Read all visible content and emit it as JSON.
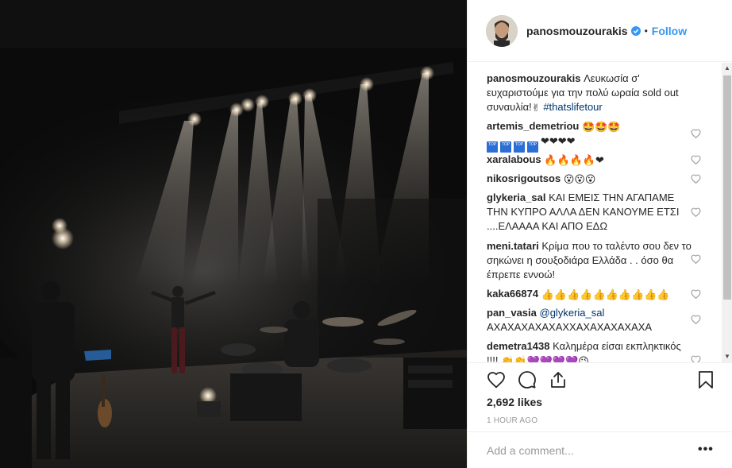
{
  "post": {
    "username": "panosmouzourakis",
    "separator": "•",
    "follow_label": "Follow",
    "caption": {
      "user": "panosmouzourakis",
      "text": "Λευκωσία σ' ευχαριστούμε για την πολύ ωραία sold out συναυλία!",
      "emoji": "✌",
      "hashtag": "#thatslifetour"
    },
    "likes": "2,692 likes",
    "time_ago": "1 HOUR AGO",
    "add_comment_placeholder": "Add a comment...",
    "more_label": "•••"
  },
  "comments": [
    {
      "user": "artemis_demetriou",
      "text": "",
      "emoji_line1": "🤩🤩🤩",
      "emoji_line2": "❤❤❤❤"
    },
    {
      "user": "xaralabous",
      "text": "",
      "emoji": "🔥🔥🔥🔥❤"
    },
    {
      "user": "nikosrigoutsos",
      "text": "",
      "emoji": "😮😮😮"
    },
    {
      "user": "glykeria_sal",
      "text": "ΚΑΙ ΕΜΕΙΣ ΤΗΝ ΑΓΑΠΑΜΕ ΤΗΝ ΚΥΠΡΟ ΑΛΛΑ ΔΕΝ ΚΑΝΟΥΜΕ ΕΤΣΙ ....ΕΛΑΑΑΑ ΚΑΙ ΑΠΟ ΕΔΩ"
    },
    {
      "user": "meni.tatari",
      "text": "Κρίμα που το ταλέντο σου δεν το σηκώνει η σουξοδιάρα Ελλάδα . . όσο θα έπρεπε εννοώ!"
    },
    {
      "user": "kaka66874",
      "text": "",
      "emoji": "👍👍👍👍👍👍👍👍👍👍"
    },
    {
      "user": "pan_vasia",
      "mention": "@glykeria_sal",
      "text": "ΑΧΑΧΑΧΑΧΑΧΑΧΧΑΧΑΧΑΧΑΧΑΧΑ"
    },
    {
      "user": "demetra1438",
      "text": "Καλημέρα είσαι εκπληκτικός !!!!",
      "emoji": "👏👏💜💜💜💜😉"
    }
  ],
  "top_badge_label": "TOP",
  "colors": {
    "link": "#3897f0",
    "hashtag": "#003569",
    "muted": "#999999",
    "text": "#262626",
    "border": "#efefef"
  },
  "icons": [
    "verified-badge-icon",
    "heart-outline-icon",
    "comment-bubble-icon",
    "share-icon",
    "bookmark-icon",
    "scroll-up-icon",
    "scroll-down-icon"
  ]
}
